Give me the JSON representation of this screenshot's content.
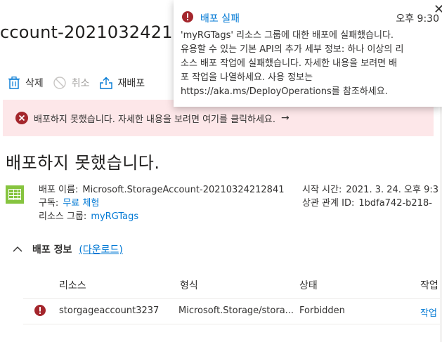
{
  "page": {
    "title": "ccount-202103242128"
  },
  "toolbar": {
    "delete_label": "삭제",
    "cancel_label": "취소",
    "redeploy_label": "재배포"
  },
  "error_bar": {
    "message": "배포하지 못했습니다. 자세한 내용을 보려면 여기를 클릭하세요.",
    "arrow": "→"
  },
  "heading": "배포하지 못했습니다.",
  "deployment": {
    "name_label": "배포 이름:",
    "name_value": "Microsoft.StorageAccount-20210324212841",
    "subscription_label": "구독:",
    "subscription_value": "무료 체험",
    "rg_label": "리소스 그룹:",
    "rg_value": "myRGTags",
    "start_label": "시작 시간:",
    "start_value": "2021. 3. 24. 오후 9:3",
    "corr_label": "상관 관계 ID:",
    "corr_value": "1bdfa742-b218-"
  },
  "details": {
    "title": "배포 정보",
    "download": "(다운로드)"
  },
  "table": {
    "headers": [
      "리소스",
      "형식",
      "상태",
      "작업"
    ],
    "rows": [
      {
        "resource": "storgageaccount3237",
        "type": "Microsoft.Storage/stora...",
        "status": "Forbidden",
        "action": "작업"
      }
    ]
  },
  "toast": {
    "title": "배포 실패",
    "time": "오후 9:30",
    "body": "'myRGTags' 리소스 그룹에 대한 배포에 실패했습니다.\n유용할 수 있는 기본 API의 추가 세부 정보: 하나 이상의 리\n소스 배포 작업에 실패했습니다. 자세한 내용을 보려면 배\n포 작업을 나열하세요. 사용 정보는\nhttps://aka.ms/DeployOperations를 참조하세요."
  },
  "colors": {
    "error_red": "#a4262c",
    "link_blue": "#0078d4",
    "error_bg": "#fde7e9",
    "icon_green": "#86c43f"
  }
}
